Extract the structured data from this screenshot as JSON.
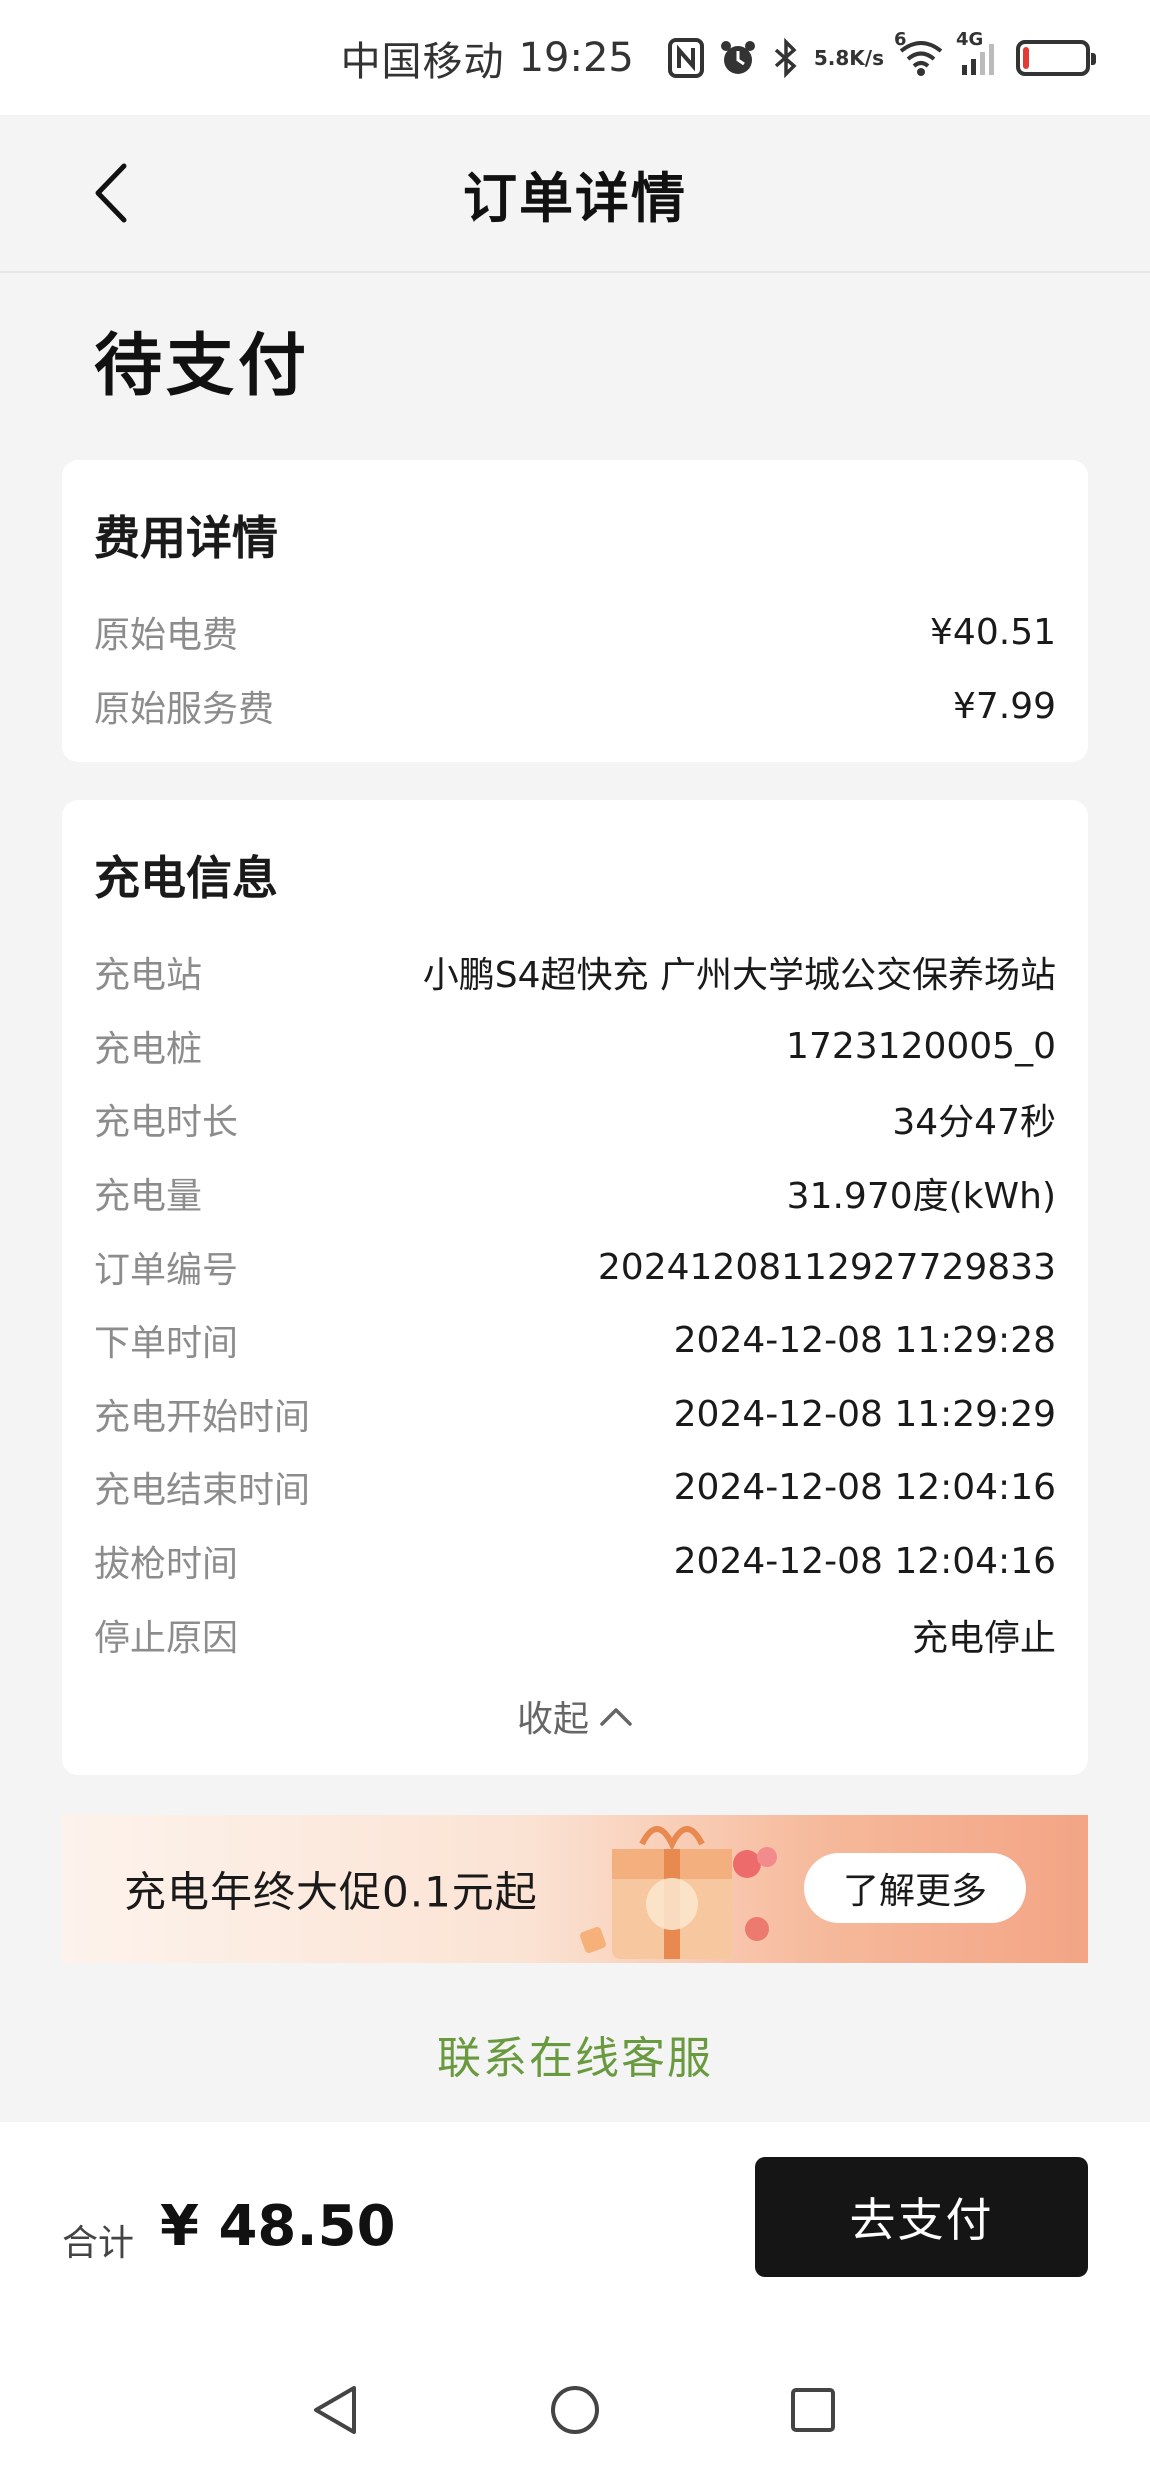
{
  "status_bar": {
    "carrier": "中国移动",
    "time": "19:25",
    "speed_value": "5.8",
    "speed_unit": "K/s",
    "wifi_badge": "6",
    "network": "4G"
  },
  "nav": {
    "title": "订单详情"
  },
  "order_status": "待支付",
  "fee_details": {
    "title": "费用详情",
    "rows": [
      {
        "label": "原始电费",
        "value": "¥40.51"
      },
      {
        "label": "原始服务费",
        "value": "¥7.99"
      }
    ]
  },
  "charge_info": {
    "title": "充电信息",
    "rows": [
      {
        "label": "充电站",
        "value": "小鹏S4超快充 广州大学城公交保养场站"
      },
      {
        "label": "充电桩",
        "value": "1723120005_0"
      },
      {
        "label": "充电时长",
        "value": "34分47秒"
      },
      {
        "label": "充电量",
        "value": "31.970度(kWh)"
      },
      {
        "label": "订单编号",
        "value": "20241208112927729833"
      },
      {
        "label": "下单时间",
        "value": "2024-12-08 11:29:28"
      },
      {
        "label": "充电开始时间",
        "value": "2024-12-08 11:29:29"
      },
      {
        "label": "充电结束时间",
        "value": "2024-12-08 12:04:16"
      },
      {
        "label": "拔枪时间",
        "value": "2024-12-08 12:04:16"
      },
      {
        "label": "停止原因",
        "value": "充电停止"
      }
    ],
    "collapse_label": "收起"
  },
  "banner": {
    "text": "充电年终大促0.1元起",
    "button_label": "了解更多"
  },
  "service_link": "联系在线客服",
  "footer": {
    "total_label": "合计",
    "total_amount": "¥ 48.50",
    "pay_button": "去支付"
  },
  "colors": {
    "accent_green": "#6a9a3f",
    "pay_button_bg": "#151515",
    "battery_low": "#e53935"
  }
}
